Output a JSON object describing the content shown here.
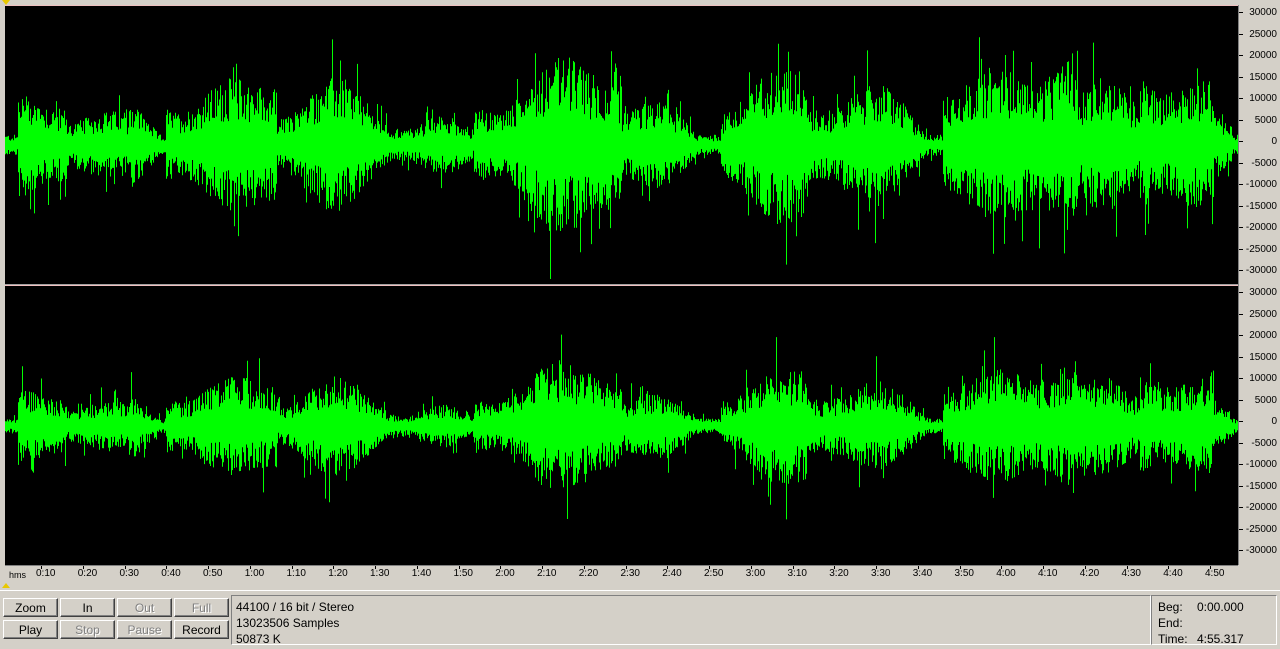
{
  "colors": {
    "waveform": "#00ff00",
    "background": "#000000",
    "channel_divider": "#f0c0c0",
    "panel": "#d4d0c8"
  },
  "amplitude_ruler": {
    "labels": [
      "30000",
      "25000",
      "20000",
      "15000",
      "10000",
      "5000",
      "0",
      "-5000",
      "-10000",
      "-15000",
      "-20000",
      "-25000",
      "-30000"
    ]
  },
  "time_ruler": {
    "unit": "hms",
    "labels": [
      "0:10",
      "0:20",
      "0:30",
      "0:40",
      "0:50",
      "1:00",
      "1:10",
      "1:20",
      "1:30",
      "1:40",
      "1:50",
      "2:00",
      "2:10",
      "2:20",
      "2:30",
      "2:40",
      "2:50",
      "3:00",
      "3:10",
      "3:20",
      "3:30",
      "3:40",
      "3:50",
      "4:00",
      "4:10",
      "4:20",
      "4:30",
      "4:40",
      "4:50"
    ]
  },
  "buttons": {
    "zoom": "Zoom",
    "in": "In",
    "out": "Out",
    "full": "Full",
    "play": "Play",
    "stop": "Stop",
    "pause": "Pause",
    "record": "Record"
  },
  "info": {
    "format": "44100 / 16 bit / Stereo",
    "samples": "13023506 Samples",
    "size": "50873 K"
  },
  "time_box": {
    "beg_label": "Beg:",
    "beg_value": "0:00.000",
    "end_label": "End:",
    "end_value": "",
    "time_label": "Time:",
    "time_value": "4:55.317"
  }
}
